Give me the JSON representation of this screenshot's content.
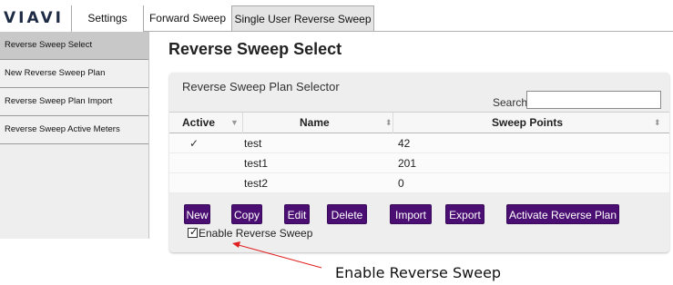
{
  "brand": {
    "logo": "VIAVI"
  },
  "tabs": [
    {
      "label": "Settings"
    },
    {
      "label": "Forward Sweep"
    },
    {
      "label": "Single User Reverse Sweep",
      "selected": true
    }
  ],
  "sidebar": {
    "items": [
      {
        "label": "Reverse Sweep Select",
        "selected": true
      },
      {
        "label": "New Reverse Sweep Plan"
      },
      {
        "label": "Reverse Sweep Plan Import"
      },
      {
        "label": "Reverse Sweep Active Meters"
      }
    ]
  },
  "main": {
    "title": "Reverse Sweep Select",
    "panel": {
      "title": "Reverse Sweep Plan Selector",
      "search": {
        "label": "Search:",
        "value": "",
        "placeholder": ""
      },
      "table": {
        "columns": [
          "Active",
          "Name",
          "Sweep Points"
        ],
        "rows": [
          {
            "active": "✓",
            "name": "test",
            "points": "42"
          },
          {
            "active": "",
            "name": "test1",
            "points": "201"
          },
          {
            "active": "",
            "name": "test2",
            "points": "0"
          }
        ]
      },
      "buttons": {
        "new": "New",
        "copy": "Copy",
        "edit": "Edit",
        "delete": "Delete",
        "import": "Import",
        "export": "Export",
        "activate": "Activate Reverse Plan"
      },
      "enable_reverse_sweep": {
        "label": "Enable Reverse Sweep",
        "checked": true
      }
    }
  },
  "annotation": {
    "text": "Enable Reverse Sweep",
    "color": "#e02020"
  },
  "colors": {
    "button_bg": "#4b0f73",
    "sidebar_active": "#c8c8c8"
  }
}
